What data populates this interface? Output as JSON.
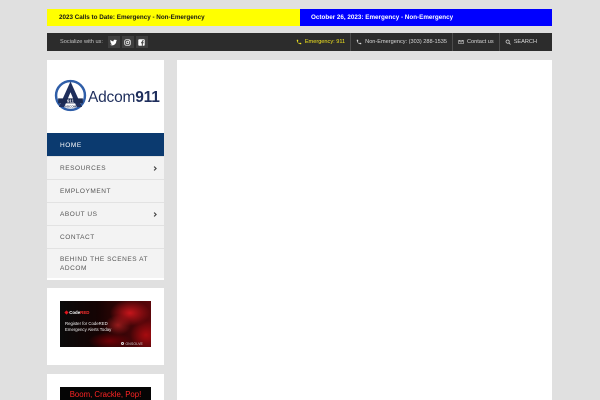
{
  "theme": {
    "page-bg": "#e0e0e0",
    "alert-yellow": "#ffff00",
    "alert-blue": "#0000ff",
    "topbar-bg": "#2c2c2c",
    "emergency-yellow": "#f2e51e",
    "nav-active": "#0b3a6f",
    "logo-navy": "#1e2e5c",
    "logo-ring": "#2f5ea8",
    "promo-red": "#ff2424"
  },
  "alert_bar": {
    "calls_to_date": "2023 Calls to Date: Emergency - Non-Emergency",
    "daily": "October 26, 2023: Emergency - Non-Emergency"
  },
  "topbar": {
    "social_label": "Socialize with us:",
    "social_icons": [
      "twitter-icon",
      "instagram-icon",
      "facebook-icon"
    ],
    "links": [
      {
        "label": "Emergency: 911",
        "icon": "phone-icon"
      },
      {
        "label": "Non-Emergency: (303) 288-1535",
        "icon": "phone-icon"
      },
      {
        "label": "Contact us",
        "icon": "envelope-icon"
      },
      {
        "label": "SEARCH",
        "icon": "search-icon"
      }
    ]
  },
  "logo": {
    "wordmark": "Adcom",
    "wordmark_bold": "911",
    "emblem_band": "911",
    "emblem_caption": "ADCOM"
  },
  "nav": {
    "items": [
      {
        "label": "HOME",
        "active": true
      },
      {
        "label": "RESOURCES",
        "icon": "chevron-right-icon"
      },
      {
        "label": "EMPLOYMENT"
      },
      {
        "label": "ABOUT US",
        "icon": "chevron-right-icon"
      },
      {
        "label": "CONTACT"
      },
      {
        "label": "BEHIND THE SCENES AT ADCOM"
      }
    ]
  },
  "widgets": {
    "codered": {
      "brand_code": "Code",
      "brand_red": "RED",
      "line1": "Register for CodeRED",
      "line2": "Emergency Alerts Today",
      "vendor": "ONSOLVE"
    },
    "fireworks": {
      "text": "Boom, Crackle, Pop!"
    }
  }
}
